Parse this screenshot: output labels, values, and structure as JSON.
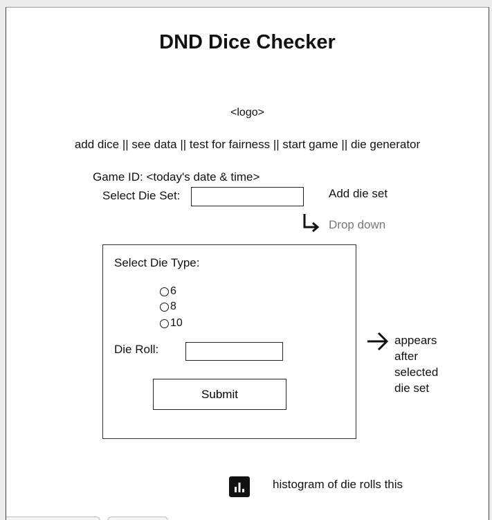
{
  "title": "DND Dice Checker",
  "logo_placeholder": "<logo>",
  "nav": {
    "items": [
      "add dice",
      "see data",
      "test for fairness",
      "start game",
      "die generator"
    ],
    "separator": " || "
  },
  "game_id": {
    "label": "Game ID:",
    "value": "<today's date & time>"
  },
  "die_set": {
    "label": "Select Die Set:",
    "value": "",
    "add_label": "Add die set",
    "dropdown_note": "Drop down"
  },
  "panel": {
    "die_type_label": "Select Die Type:",
    "die_types": [
      "6",
      "8",
      "10"
    ],
    "die_roll_label": "Die Roll:",
    "die_roll_value": "",
    "submit_label": "Submit"
  },
  "annotation": {
    "lines": [
      "appears",
      "after",
      "selected",
      "die set"
    ]
  },
  "histogram": {
    "icon": "bar-chart-icon",
    "label": "histogram of die rolls this"
  },
  "colors": {
    "text": "#111111",
    "muted": "#777777",
    "icon_bg": "#111111"
  }
}
